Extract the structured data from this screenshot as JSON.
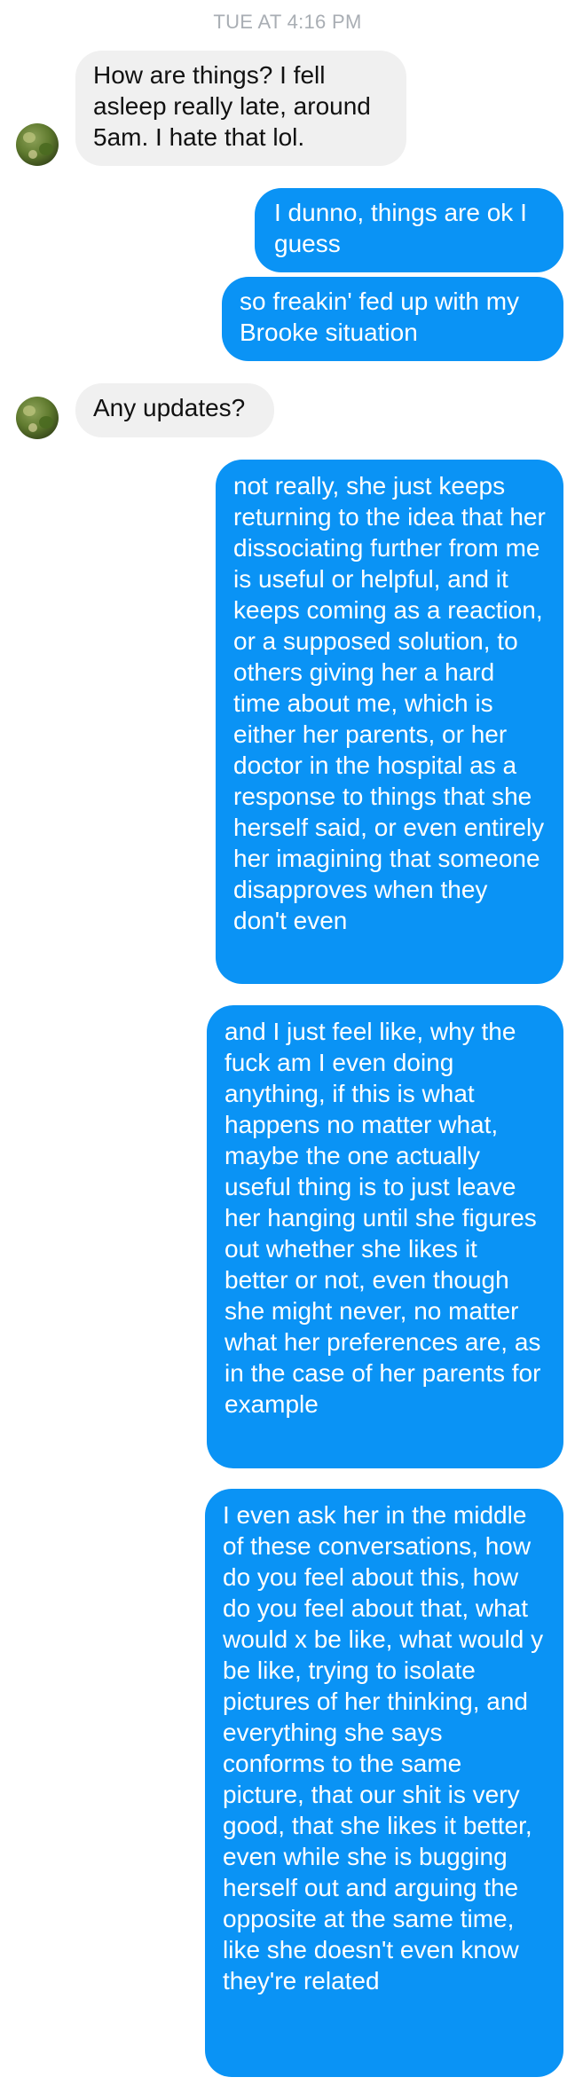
{
  "thread": {
    "timestamp": "TUE AT 4:16 PM",
    "contact_avatar_icon": "avatar-icon",
    "colors": {
      "incoming_bubble": "#f0f0f0",
      "outgoing_bubble": "#0a93f5",
      "timestamp_text": "#a9aeb4"
    },
    "messages": [
      {
        "direction": "incoming",
        "text": "How are things? I fell asleep really late, around 5am. I hate that lol."
      },
      {
        "direction": "outgoing",
        "text": "I dunno, things are ok I guess"
      },
      {
        "direction": "outgoing",
        "text": "so freakin' fed up with my Brooke situation"
      },
      {
        "direction": "incoming",
        "text": "Any updates?"
      },
      {
        "direction": "outgoing",
        "text": "not really, she just keeps returning to the idea that her dissociating further from me is useful or helpful, and it keeps coming as a reaction, or a supposed solution, to others giving her a hard time about me, which is either her parents, or her doctor in the hospital as a response to things that she herself said, or even entirely her imagining that someone disapproves when they don't even"
      },
      {
        "direction": "outgoing",
        "text": "and I just feel like, why the fuck am I even doing anything, if this is what happens no matter what, maybe the one actually useful thing is to just leave her hanging until she figures out whether she likes it better or not, even though she might never, no matter what her preferences are, as in the case of her parents for example"
      },
      {
        "direction": "outgoing",
        "text": "I even ask her in the middle of these conversations, how do you feel about this, how do you feel about that, what would x be like, what would y be like, trying to isolate pictures of her thinking, and everything she says conforms to the same picture, that our shit is very good, that she likes it better, even while she is bugging herself out and arguing the opposite at the same time, like she doesn't even know they're related"
      }
    ]
  }
}
